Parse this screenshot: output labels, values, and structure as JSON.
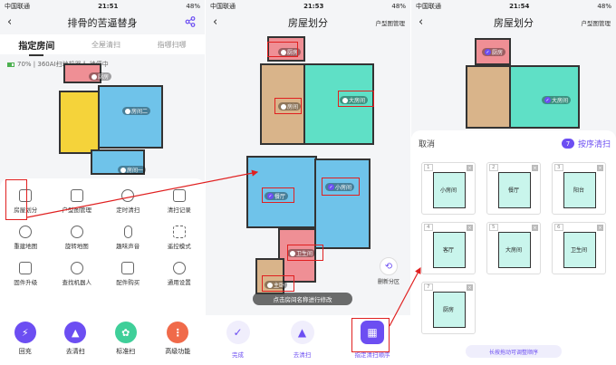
{
  "colors": {
    "accent": "#6c4ef2",
    "highlight": "#e02020",
    "room_blue": "#6fc3ea",
    "room_yellow": "#f5d33a",
    "room_tan": "#d9b48a",
    "room_teal": "#5fe0c6",
    "room_pink": "#ef8f95"
  },
  "panel1": {
    "status": {
      "carrier": "中国联通",
      "time": "21:51",
      "battery": "48%"
    },
    "title": "排骨的苦逼替身",
    "tabs": [
      "指定房间",
      "全屋清扫",
      "指哪扫哪"
    ],
    "robot_status": "70% | 360AI扫地机器人 待停中",
    "map_labels": [
      "厨房",
      "房间二",
      "房间一"
    ],
    "grid_items": [
      "房屋划分",
      "户型图管理",
      "定时清扫",
      "清扫记录",
      "重建地图",
      "旋转地图",
      "趣味声音",
      "遥控模式",
      "固件升级",
      "查找机器人",
      "配件购买",
      "通用设置"
    ],
    "bottom_actions": [
      {
        "label": "回充",
        "icon": "recharge-icon",
        "color": "#6c4ef2"
      },
      {
        "label": "去清扫",
        "icon": "clean-icon",
        "color": "#6c4ef2"
      },
      {
        "label": "标准扫",
        "icon": "fan-icon",
        "color": "#3fcf99"
      },
      {
        "label": "高级功能",
        "icon": "more-icon",
        "color": "#f06a4a"
      }
    ]
  },
  "panel2": {
    "status": {
      "carrier": "中国联通",
      "time": "21:53",
      "battery": "48%"
    },
    "title": "房屋划分",
    "right_action": "户型图管理",
    "map_labels": [
      "厨房",
      "房间",
      "大房间",
      "餐厅",
      "小房间",
      "卫生间",
      "主卧"
    ],
    "toast": "点击房间名称进行修改",
    "partition_label": "删新分区",
    "bottom_actions": [
      "完成",
      "去清扫",
      "指定清扫顺序"
    ]
  },
  "panel3": {
    "status": {
      "carrier": "中国联通",
      "time": "21:54",
      "battery": "48%"
    },
    "title": "房屋划分",
    "right_action": "户型图管理",
    "map_labels": [
      "厨房",
      "大房间"
    ],
    "cancel": "取消",
    "order_count": "7",
    "order_label": "按序清扫",
    "rooms": [
      {
        "num": "1",
        "name": "小房间"
      },
      {
        "num": "2",
        "name": "餐厅"
      },
      {
        "num": "3",
        "name": "阳台"
      },
      {
        "num": "4",
        "name": "客厅"
      },
      {
        "num": "5",
        "name": "大房间"
      },
      {
        "num": "6",
        "name": "卫生间"
      },
      {
        "num": "7",
        "name": "厨房"
      }
    ],
    "hint": "长按拖动可调整顺序"
  }
}
